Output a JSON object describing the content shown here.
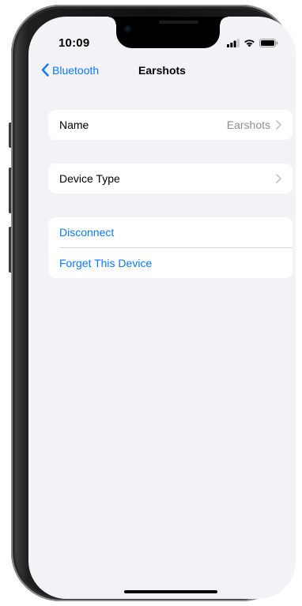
{
  "status_bar": {
    "time": "10:09"
  },
  "nav": {
    "back_label": "Bluetooth",
    "title": "Earshots"
  },
  "settings": {
    "name_row": {
      "label": "Name",
      "value": "Earshots"
    },
    "device_type_row": {
      "label": "Device Type"
    },
    "actions": {
      "disconnect": "Disconnect",
      "forget": "Forget This Device"
    }
  },
  "colors": {
    "accent": "#0A7AFF",
    "background": "#F2F2F7",
    "secondary_text": "#8E8E93"
  }
}
